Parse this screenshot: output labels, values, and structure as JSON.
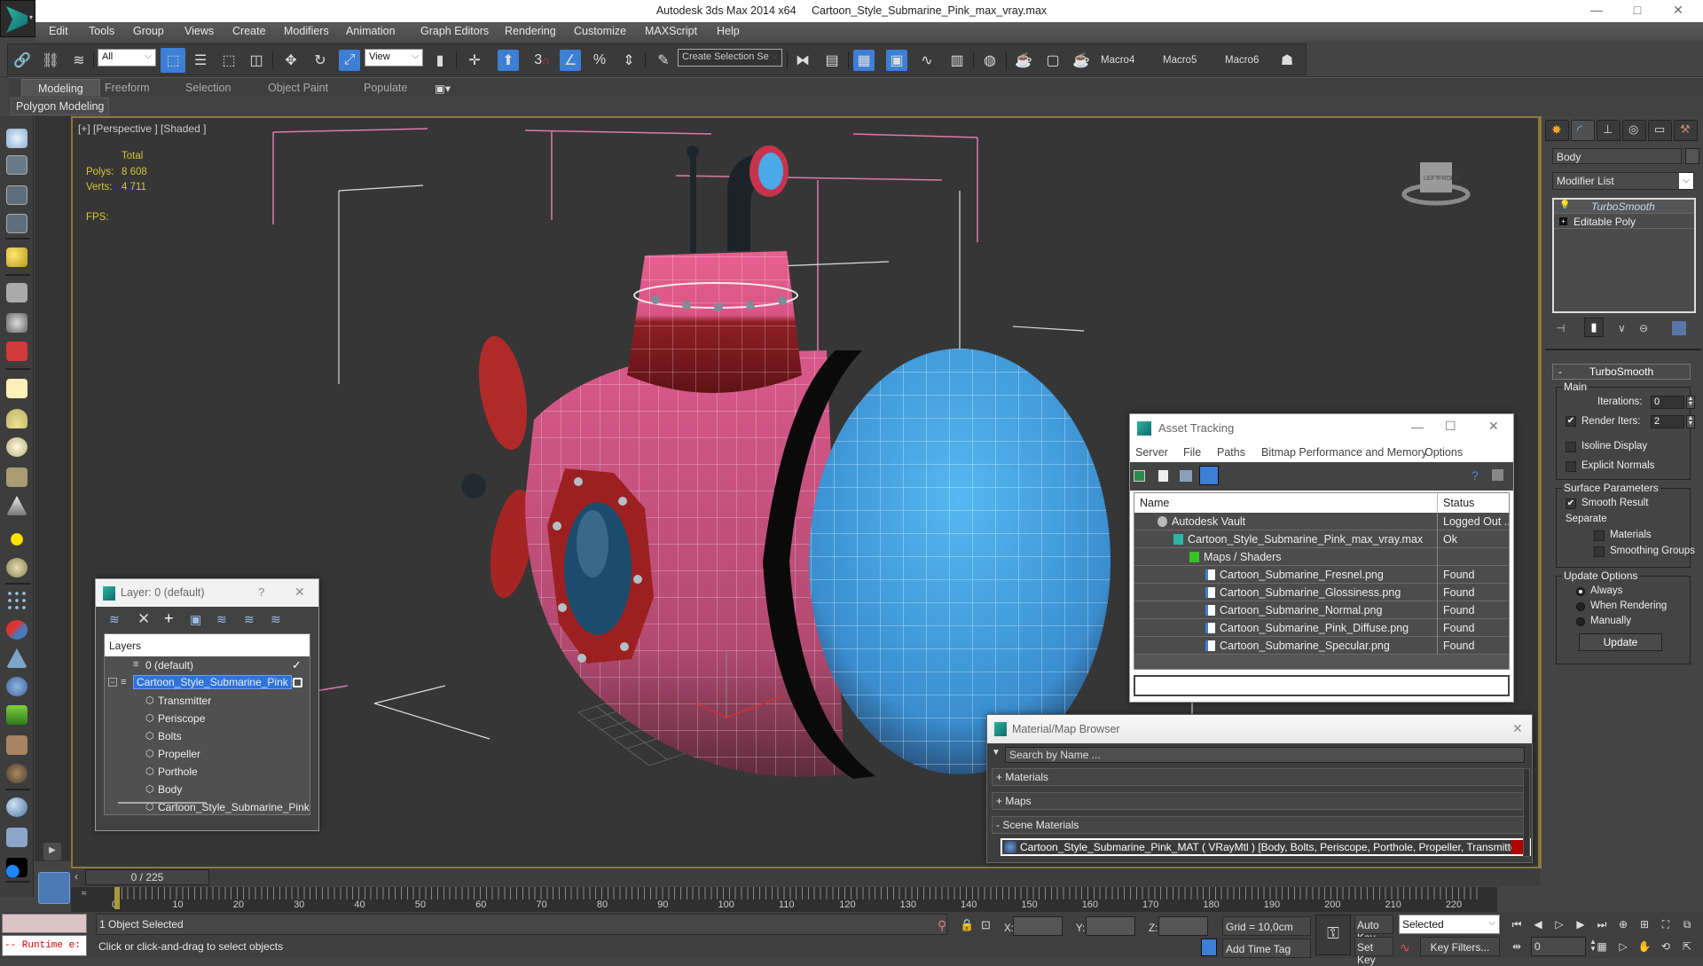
{
  "window": {
    "app_title": "Autodesk 3ds Max  2014 x64",
    "file_name": "Cartoon_Style_Submarine_Pink_max_vray.max",
    "controls": {
      "minimize": "—",
      "restore": "□",
      "close": "✕"
    }
  },
  "menu": [
    "Edit",
    "Tools",
    "Group",
    "Views",
    "Create",
    "Modifiers",
    "Animation",
    "Graph Editors",
    "Rendering",
    "Customize",
    "MAXScript",
    "Help"
  ],
  "toolbar": {
    "selection_filter": "All",
    "reference_coord": "View",
    "named_selection_placeholder": "Create Selection Se",
    "macros": [
      "Macro4",
      "Macro5",
      "Macro6"
    ],
    "snap_label": "3"
  },
  "ribbon": {
    "tabs": [
      "Modeling",
      "Freeform",
      "Selection",
      "Object Paint",
      "Populate"
    ],
    "active_tab": "Modeling",
    "panel": "Polygon Modeling"
  },
  "viewport": {
    "label": "[+] [Perspective ] [Shaded ]",
    "stats": {
      "header": "Total",
      "polys_label": "Polys:",
      "polys": "8 608",
      "verts_label": "Verts:",
      "verts": "4 711",
      "fps_label": "FPS:"
    },
    "viewcube": {
      "left": "LEFT",
      "front": "FRONT"
    }
  },
  "asset_tracking": {
    "title": "Asset Tracking",
    "menu": [
      "Server",
      "File",
      "Paths",
      "Bitmap Performance and Memory",
      "Options"
    ],
    "columns": [
      "Name",
      "Status"
    ],
    "rows": [
      {
        "name": "Autodesk Vault",
        "status": "Logged Out ...",
        "level": 1,
        "icon": "vault-icon"
      },
      {
        "name": "Cartoon_Style_Submarine_Pink_max_vray.max",
        "status": "Ok",
        "level": 2,
        "icon": "max-file-icon"
      },
      {
        "name": "Maps / Shaders",
        "status": "",
        "level": 3,
        "icon": "maps-folder-icon"
      },
      {
        "name": "Cartoon_Submarine_Fresnel.png",
        "status": "Found",
        "level": 4,
        "icon": "image-file-icon"
      },
      {
        "name": "Cartoon_Submarine_Glossiness.png",
        "status": "Found",
        "level": 4,
        "icon": "image-file-icon"
      },
      {
        "name": "Cartoon_Submarine_Normal.png",
        "status": "Found",
        "level": 4,
        "icon": "image-file-icon"
      },
      {
        "name": "Cartoon_Submarine_Pink_Diffuse.png",
        "status": "Found",
        "level": 4,
        "icon": "image-file-icon"
      },
      {
        "name": "Cartoon_Submarine_Specular.png",
        "status": "Found",
        "level": 4,
        "icon": "image-file-icon"
      }
    ]
  },
  "material_browser": {
    "title": "Material/Map Browser",
    "search_placeholder": "Search by Name ...",
    "sections": [
      "+ Materials",
      "+ Maps",
      "- Scene Materials"
    ],
    "scene_material": "Cartoon_Style_Submarine_Pink_MAT ( VRayMtl ) [Body, Bolts, Periscope, Porthole, Propeller, Transmitter]"
  },
  "layer_window": {
    "title": "Layer: 0 (default)",
    "help": "?",
    "list_header": "Layers",
    "layers": [
      {
        "name": "0 (default)",
        "type": "layer",
        "indent": 1,
        "current": true
      },
      {
        "name": "Cartoon_Style_Submarine_Pink",
        "type": "layer",
        "indent": 0,
        "selected": true
      },
      {
        "name": "Transmitter",
        "type": "object",
        "indent": 2
      },
      {
        "name": "Periscope",
        "type": "object",
        "indent": 2
      },
      {
        "name": "Bolts",
        "type": "object",
        "indent": 2
      },
      {
        "name": "Propeller",
        "type": "object",
        "indent": 2
      },
      {
        "name": "Porthole",
        "type": "object",
        "indent": 2
      },
      {
        "name": "Body",
        "type": "object",
        "indent": 2
      },
      {
        "name": "Cartoon_Style_Submarine_Pink",
        "type": "object",
        "indent": 2
      }
    ]
  },
  "command_panel": {
    "object_name": "Body",
    "modifier_list": "Modifier List",
    "stack": [
      {
        "name": "TurboSmooth",
        "italic": true
      },
      {
        "name": "Editable Poly",
        "italic": false
      }
    ],
    "rollout": {
      "title": "TurboSmooth",
      "collapse": "-",
      "main_label": "Main",
      "iterations_label": "Iterations:",
      "iterations": "0",
      "render_iters_label": "Render Iters:",
      "render_iters": "2",
      "render_iters_checked": true,
      "isoline_label": "Isoline Display",
      "isoline_checked": false,
      "explicit_normals_label": "Explicit Normals",
      "explicit_normals_checked": false,
      "surface_label": "Surface Parameters",
      "smooth_result_label": "Smooth Result",
      "smooth_result_checked": true,
      "separate_label": "Separate",
      "materials_label": "Materials",
      "smoothing_groups_label": "Smoothing Groups",
      "update_options_label": "Update Options",
      "update_options": [
        "Always",
        "When Rendering",
        "Manually"
      ],
      "update_selected": "Always",
      "update_button": "Update"
    }
  },
  "timeline": {
    "frame_display": "0 / 225",
    "current_frame": 0,
    "total_frames": 225,
    "ticks": [
      "0",
      "10",
      "20",
      "30",
      "40",
      "50",
      "60",
      "70",
      "80",
      "90",
      "100",
      "110",
      "120",
      "130",
      "140",
      "150",
      "160",
      "170",
      "180",
      "190",
      "200",
      "210",
      "220"
    ]
  },
  "status": {
    "maxscript_output": "-- Runtime e:",
    "selection": "1 Object Selected",
    "prompt": "Click or click-and-drag to select objects",
    "x_label": "X:",
    "y_label": "Y:",
    "z_label": "Z:",
    "grid": "Grid = 10,0cm",
    "add_time_tag": "Add Time Tag",
    "auto_key": "Auto Key",
    "set_key": "Set Key",
    "key_mode": "Selected",
    "key_filters": "Key Filters...",
    "frame_field": "0"
  },
  "colors": {
    "accent_blue": "#3c7fd4",
    "viewport_border": "#8c7a3c",
    "stats_yellow": "#d6c638",
    "submarine_pink": "#d04f7e",
    "submarine_blue": "#4aaee8"
  }
}
